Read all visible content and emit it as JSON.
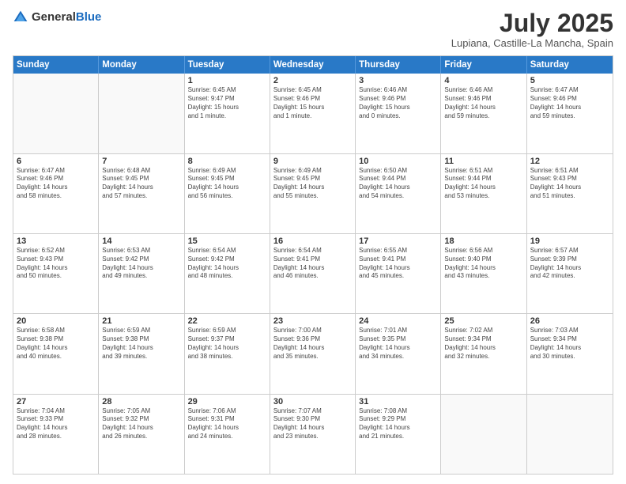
{
  "header": {
    "logo_general": "General",
    "logo_blue": "Blue",
    "title": "July 2025",
    "subtitle": "Lupiana, Castille-La Mancha, Spain"
  },
  "calendar": {
    "days_of_week": [
      "Sunday",
      "Monday",
      "Tuesday",
      "Wednesday",
      "Thursday",
      "Friday",
      "Saturday"
    ],
    "weeks": [
      [
        {
          "day": "",
          "lines": []
        },
        {
          "day": "",
          "lines": []
        },
        {
          "day": "1",
          "lines": [
            "Sunrise: 6:45 AM",
            "Sunset: 9:47 PM",
            "Daylight: 15 hours",
            "and 1 minute."
          ]
        },
        {
          "day": "2",
          "lines": [
            "Sunrise: 6:45 AM",
            "Sunset: 9:46 PM",
            "Daylight: 15 hours",
            "and 1 minute."
          ]
        },
        {
          "day": "3",
          "lines": [
            "Sunrise: 6:46 AM",
            "Sunset: 9:46 PM",
            "Daylight: 15 hours",
            "and 0 minutes."
          ]
        },
        {
          "day": "4",
          "lines": [
            "Sunrise: 6:46 AM",
            "Sunset: 9:46 PM",
            "Daylight: 14 hours",
            "and 59 minutes."
          ]
        },
        {
          "day": "5",
          "lines": [
            "Sunrise: 6:47 AM",
            "Sunset: 9:46 PM",
            "Daylight: 14 hours",
            "and 59 minutes."
          ]
        }
      ],
      [
        {
          "day": "6",
          "lines": [
            "Sunrise: 6:47 AM",
            "Sunset: 9:46 PM",
            "Daylight: 14 hours",
            "and 58 minutes."
          ]
        },
        {
          "day": "7",
          "lines": [
            "Sunrise: 6:48 AM",
            "Sunset: 9:45 PM",
            "Daylight: 14 hours",
            "and 57 minutes."
          ]
        },
        {
          "day": "8",
          "lines": [
            "Sunrise: 6:49 AM",
            "Sunset: 9:45 PM",
            "Daylight: 14 hours",
            "and 56 minutes."
          ]
        },
        {
          "day": "9",
          "lines": [
            "Sunrise: 6:49 AM",
            "Sunset: 9:45 PM",
            "Daylight: 14 hours",
            "and 55 minutes."
          ]
        },
        {
          "day": "10",
          "lines": [
            "Sunrise: 6:50 AM",
            "Sunset: 9:44 PM",
            "Daylight: 14 hours",
            "and 54 minutes."
          ]
        },
        {
          "day": "11",
          "lines": [
            "Sunrise: 6:51 AM",
            "Sunset: 9:44 PM",
            "Daylight: 14 hours",
            "and 53 minutes."
          ]
        },
        {
          "day": "12",
          "lines": [
            "Sunrise: 6:51 AM",
            "Sunset: 9:43 PM",
            "Daylight: 14 hours",
            "and 51 minutes."
          ]
        }
      ],
      [
        {
          "day": "13",
          "lines": [
            "Sunrise: 6:52 AM",
            "Sunset: 9:43 PM",
            "Daylight: 14 hours",
            "and 50 minutes."
          ]
        },
        {
          "day": "14",
          "lines": [
            "Sunrise: 6:53 AM",
            "Sunset: 9:42 PM",
            "Daylight: 14 hours",
            "and 49 minutes."
          ]
        },
        {
          "day": "15",
          "lines": [
            "Sunrise: 6:54 AM",
            "Sunset: 9:42 PM",
            "Daylight: 14 hours",
            "and 48 minutes."
          ]
        },
        {
          "day": "16",
          "lines": [
            "Sunrise: 6:54 AM",
            "Sunset: 9:41 PM",
            "Daylight: 14 hours",
            "and 46 minutes."
          ]
        },
        {
          "day": "17",
          "lines": [
            "Sunrise: 6:55 AM",
            "Sunset: 9:41 PM",
            "Daylight: 14 hours",
            "and 45 minutes."
          ]
        },
        {
          "day": "18",
          "lines": [
            "Sunrise: 6:56 AM",
            "Sunset: 9:40 PM",
            "Daylight: 14 hours",
            "and 43 minutes."
          ]
        },
        {
          "day": "19",
          "lines": [
            "Sunrise: 6:57 AM",
            "Sunset: 9:39 PM",
            "Daylight: 14 hours",
            "and 42 minutes."
          ]
        }
      ],
      [
        {
          "day": "20",
          "lines": [
            "Sunrise: 6:58 AM",
            "Sunset: 9:38 PM",
            "Daylight: 14 hours",
            "and 40 minutes."
          ]
        },
        {
          "day": "21",
          "lines": [
            "Sunrise: 6:59 AM",
            "Sunset: 9:38 PM",
            "Daylight: 14 hours",
            "and 39 minutes."
          ]
        },
        {
          "day": "22",
          "lines": [
            "Sunrise: 6:59 AM",
            "Sunset: 9:37 PM",
            "Daylight: 14 hours",
            "and 38 minutes."
          ]
        },
        {
          "day": "23",
          "lines": [
            "Sunrise: 7:00 AM",
            "Sunset: 9:36 PM",
            "Daylight: 14 hours",
            "and 35 minutes."
          ]
        },
        {
          "day": "24",
          "lines": [
            "Sunrise: 7:01 AM",
            "Sunset: 9:35 PM",
            "Daylight: 14 hours",
            "and 34 minutes."
          ]
        },
        {
          "day": "25",
          "lines": [
            "Sunrise: 7:02 AM",
            "Sunset: 9:34 PM",
            "Daylight: 14 hours",
            "and 32 minutes."
          ]
        },
        {
          "day": "26",
          "lines": [
            "Sunrise: 7:03 AM",
            "Sunset: 9:34 PM",
            "Daylight: 14 hours",
            "and 30 minutes."
          ]
        }
      ],
      [
        {
          "day": "27",
          "lines": [
            "Sunrise: 7:04 AM",
            "Sunset: 9:33 PM",
            "Daylight: 14 hours",
            "and 28 minutes."
          ]
        },
        {
          "day": "28",
          "lines": [
            "Sunrise: 7:05 AM",
            "Sunset: 9:32 PM",
            "Daylight: 14 hours",
            "and 26 minutes."
          ]
        },
        {
          "day": "29",
          "lines": [
            "Sunrise: 7:06 AM",
            "Sunset: 9:31 PM",
            "Daylight: 14 hours",
            "and 24 minutes."
          ]
        },
        {
          "day": "30",
          "lines": [
            "Sunrise: 7:07 AM",
            "Sunset: 9:30 PM",
            "Daylight: 14 hours",
            "and 23 minutes."
          ]
        },
        {
          "day": "31",
          "lines": [
            "Sunrise: 7:08 AM",
            "Sunset: 9:29 PM",
            "Daylight: 14 hours",
            "and 21 minutes."
          ]
        },
        {
          "day": "",
          "lines": []
        },
        {
          "day": "",
          "lines": []
        }
      ]
    ]
  }
}
